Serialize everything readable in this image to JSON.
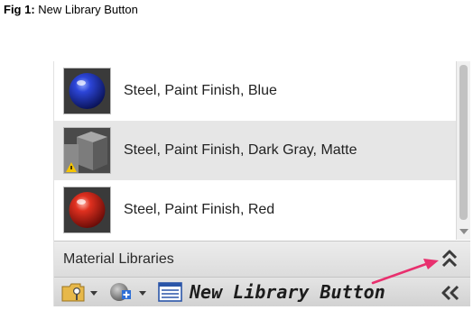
{
  "caption": {
    "number": "Fig 1:",
    "text": "New Library Button"
  },
  "materials": [
    {
      "label": "Steel, Paint Finish, Blue",
      "swatch": "blue-sphere",
      "color": "#1c2fa8"
    },
    {
      "label": "Steel, Paint Finish, Dark Gray, Matte",
      "swatch": "gray-cube-warning",
      "color": "#6a6a6a",
      "selected": true
    },
    {
      "label": "Steel, Paint Finish, Red",
      "swatch": "red-sphere",
      "color": "#d0201a"
    }
  ],
  "libraries": {
    "title": "Material Libraries"
  },
  "toolbar": {
    "new_library_label": "New Library Button",
    "icons": [
      "folder-key-icon",
      "globe-add-icon",
      "library-list-icon",
      "expand-left-icon"
    ]
  },
  "annotation": {
    "arrow_color": "#e8306e"
  }
}
